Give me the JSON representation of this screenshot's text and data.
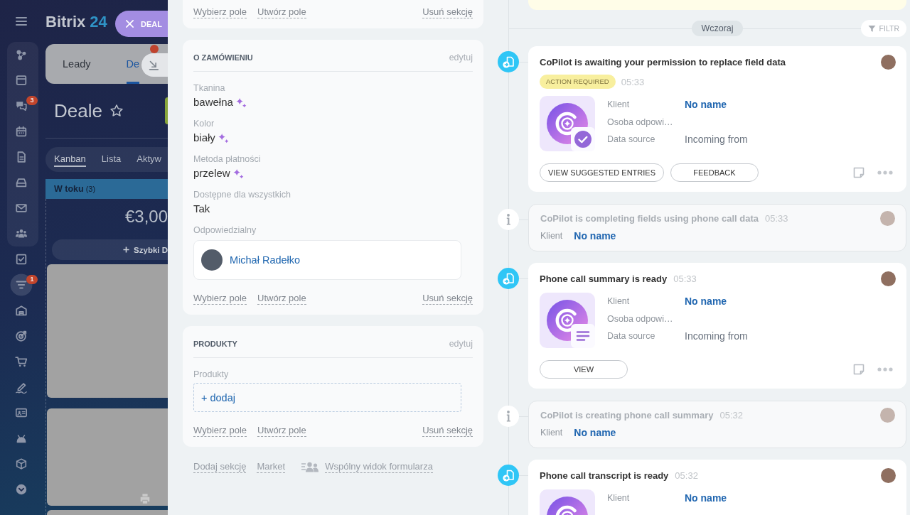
{
  "background_app": {
    "sidebar": {
      "pinned": [
        {
          "selected": false
        },
        {
          "selected": false
        },
        {
          "selected": false,
          "badge": "3"
        },
        {
          "selected": false
        },
        {
          "selected": false
        },
        {
          "selected": false
        },
        {
          "selected": false
        },
        {
          "selected": false
        }
      ],
      "items": [
        {
          "selected": false
        },
        {
          "selected": true,
          "badge": "1"
        },
        {
          "selected": false
        },
        {
          "selected": false
        },
        {
          "selected": false
        },
        {
          "selected": false
        },
        {
          "selected": false
        },
        {
          "selected": false
        },
        {
          "selected": false
        },
        {
          "selected": false
        }
      ]
    },
    "logo": {
      "name": "Bitrix",
      "number": "24"
    },
    "tabs": [
      {
        "label": "Leady",
        "selected": false,
        "notification": false
      },
      {
        "label": "De",
        "selected": true,
        "notification": true
      }
    ],
    "title": "Deale",
    "favorite": false,
    "view_tabs": [
      {
        "label": "Kanban",
        "selected": true
      },
      {
        "label": "Lista",
        "selected": false
      },
      {
        "label": "Aktyw",
        "selected": false
      }
    ],
    "column": {
      "title": "W toku",
      "count": "(3)",
      "sum": "€3,00",
      "quick_add": "Szybki D"
    }
  },
  "slider_label": {
    "text": "DEAL"
  },
  "form": {
    "sections": [
      {
        "links": [
          "Wybierz pole",
          "Utwórz pole"
        ],
        "remove": "Usuń sekcję"
      },
      {
        "title": "O ZAMÓWIENIU",
        "edit": "edytuj",
        "fields": [
          {
            "kind": "text",
            "label": "Tkanina",
            "value": "bawełna",
            "ai_filled": true
          },
          {
            "kind": "text",
            "label": "Kolor",
            "value": "biały",
            "ai_filled": true
          },
          {
            "kind": "text",
            "label": "Metoda płatności",
            "value": "przelew",
            "ai_filled": true
          },
          {
            "kind": "text",
            "label": "Dostępne dla wszystkich",
            "value": "Tak",
            "ai_filled": false
          },
          {
            "kind": "person",
            "label": "Odpowiedzialny",
            "value": "Michał Radełko"
          }
        ],
        "links": [
          "Wybierz pole",
          "Utwórz pole"
        ],
        "remove": "Usuń sekcję"
      },
      {
        "title": "PRODUKTY",
        "edit": "edytuj",
        "fields": [
          {
            "kind": "products",
            "label": "Produkty",
            "value": "+ dodaj"
          }
        ],
        "links": [
          "Wybierz pole",
          "Utwórz pole"
        ],
        "remove": "Usuń sekcję"
      }
    ],
    "bottom_links": [
      {
        "kind": "link",
        "label": "Dodaj sekcję"
      },
      {
        "kind": "link",
        "label": "Market"
      },
      {
        "kind": "shared_view",
        "label": "Wspólny widok formularza"
      }
    ]
  },
  "timeline": {
    "date": "Wczoraj",
    "filter": "FILTR",
    "items": [
      {
        "kind": "copilot",
        "title": "CoPilot is awaiting your permission to replace field data",
        "badge": "ACTION REQUIRED",
        "time": "05:33",
        "tile": {
          "kind": "check"
        },
        "fields": [
          {
            "label": "Klient",
            "value": "No name",
            "kind": "link"
          },
          {
            "label": "Osoba odpowi…"
          },
          {
            "label": "Data source",
            "value": "Incoming from",
            "kind": "text"
          }
        ],
        "buttons": [
          "VIEW SUGGESTED ENTRIES",
          "FEEDBACK"
        ]
      },
      {
        "kind": "info",
        "title": "CoPilot is completing fields using phone call data",
        "time": "05:33",
        "fields": [
          {
            "label": "Klient",
            "value": "No name",
            "kind": "link"
          }
        ]
      },
      {
        "kind": "copilot",
        "title": "Phone call summary is ready",
        "time": "05:33",
        "tile": {
          "kind": "lines"
        },
        "fields": [
          {
            "label": "Klient",
            "value": "No name",
            "kind": "link"
          },
          {
            "label": "Osoba odpowi…"
          },
          {
            "label": "Data source",
            "value": "Incoming from",
            "kind": "text"
          }
        ],
        "buttons": [
          "VIEW"
        ]
      },
      {
        "kind": "info",
        "title": "CoPilot is creating phone call summary",
        "time": "05:32",
        "fields": [
          {
            "label": "Klient",
            "value": "No name",
            "kind": "link"
          }
        ]
      },
      {
        "kind": "copilot",
        "title": "Phone call transcript is ready",
        "time": "05:32",
        "tile": {
          "kind": "plain"
        },
        "fields": [
          {
            "label": "Klient",
            "value": "No name",
            "kind": "link"
          }
        ]
      }
    ]
  }
}
